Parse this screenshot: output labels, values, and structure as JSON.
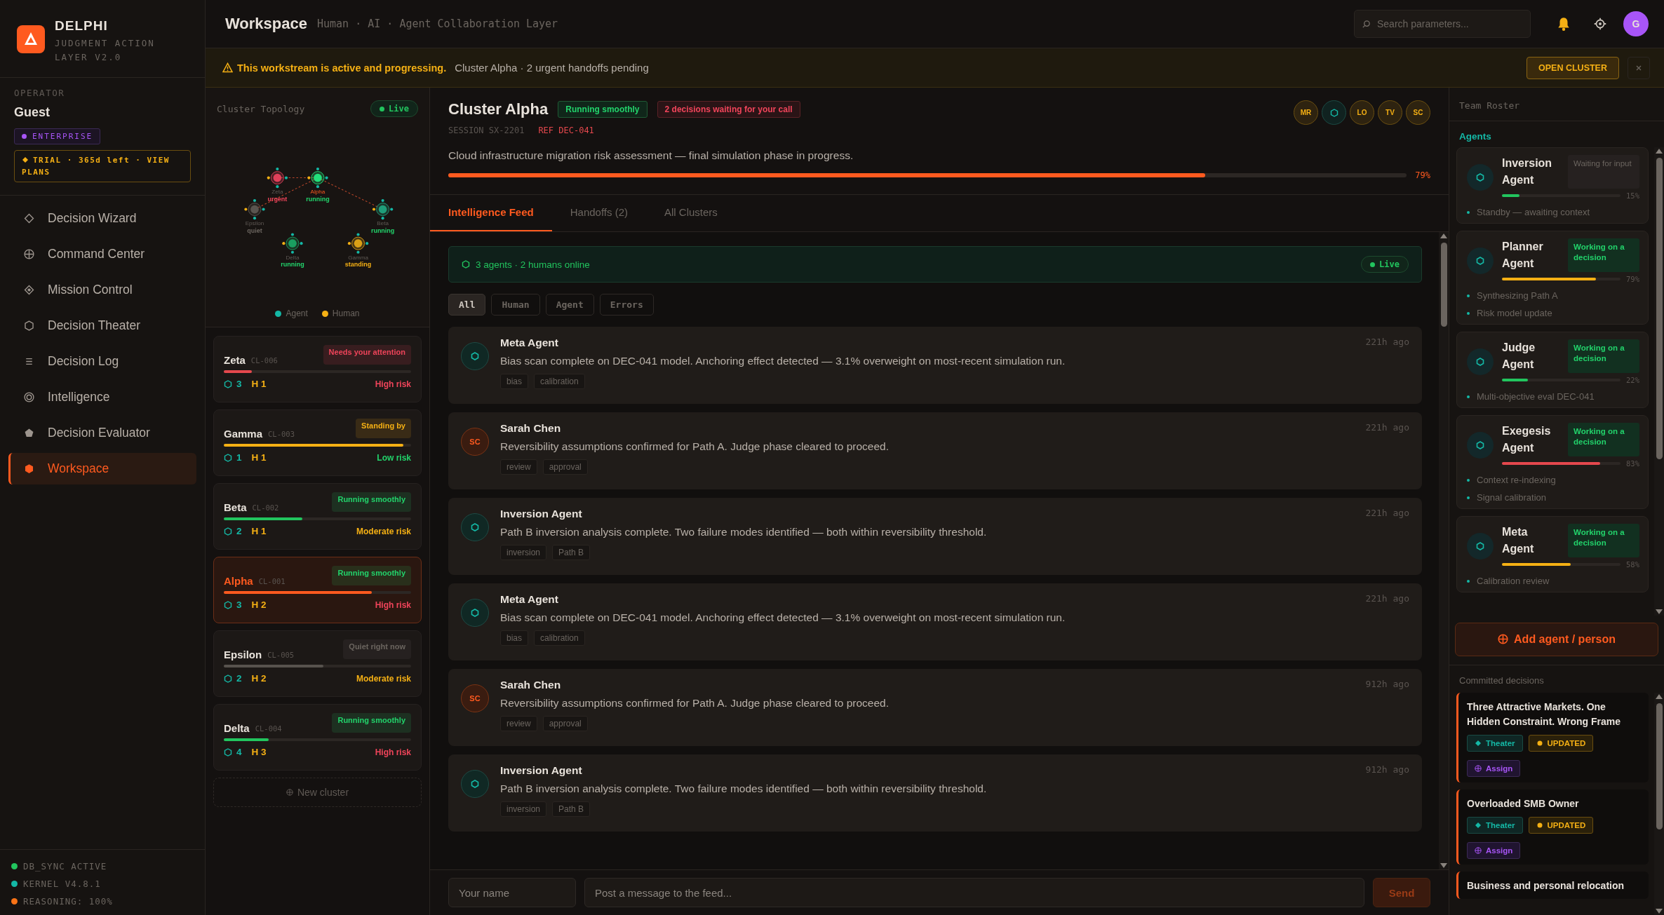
{
  "brand": {
    "name": "DELPHI",
    "tagline": "JUDGMENT ACTION LAYER V2.0"
  },
  "operator": {
    "label": "OPERATOR",
    "name": "Guest",
    "plan": "ENTERPRISE",
    "trial": "TRIAL · 365d left  ·  VIEW PLANS"
  },
  "nav": [
    {
      "label": "Decision Wizard",
      "kind": "wizard",
      "selected": false
    },
    {
      "label": "Command Center",
      "kind": "command",
      "selected": false
    },
    {
      "label": "Mission Control",
      "kind": "mission",
      "selected": false
    },
    {
      "label": "Decision Theater",
      "kind": "theater",
      "selected": false
    },
    {
      "label": "Decision Log",
      "kind": "log",
      "selected": false
    },
    {
      "label": "Intelligence",
      "kind": "intelligence",
      "selected": false
    },
    {
      "label": "Decision Evaluator",
      "kind": "evaluator",
      "selected": false
    },
    {
      "label": "Workspace",
      "kind": "workspace",
      "selected": true
    }
  ],
  "system_status": [
    {
      "label": "DB_SYNC ACTIVE",
      "color": "#22c55e"
    },
    {
      "label": "KERNEL V4.8.1",
      "color": "#14b8a6"
    },
    {
      "label": "REASONING: 100%",
      "color": "#f97316"
    }
  ],
  "header": {
    "title": "Workspace",
    "subtitle": "Human · AI · Agent Collaboration Layer",
    "search_placeholder": "Search parameters...",
    "avatar": "G"
  },
  "banner": {
    "alert": "This workstream is active and progressing.",
    "detail": "Cluster Alpha · 2 urgent handoffs pending",
    "action": "OPEN CLUSTER"
  },
  "topology": {
    "title": "Cluster Topology",
    "live": "Live",
    "nodes": [
      {
        "name": "Zeta",
        "status": {
          "text": "urgent",
          "color": "#f0445a"
        },
        "color": "#e0405a"
      },
      {
        "name": "Alpha",
        "status": {
          "text": "running",
          "color": "#22d36b"
        },
        "color": "#22e07a"
      },
      {
        "name": "Epsilon",
        "status": {
          "text": "quiet",
          "color": "#6b655f"
        },
        "color": "#5a5550"
      },
      {
        "name": "Beta",
        "status": {
          "text": "running",
          "color": "#22d36b"
        },
        "color": "#1f9e7a"
      },
      {
        "name": "Delta",
        "status": {
          "text": "running",
          "color": "#22d36b"
        },
        "color": "#1a9e60"
      },
      {
        "name": "Gamma",
        "status": {
          "text": "standing",
          "color": "#f5b014"
        },
        "color": "#d9a016"
      }
    ],
    "legend": [
      {
        "label": "Agent",
        "color": "#14b8a6"
      },
      {
        "label": "Human",
        "color": "#f5b014"
      }
    ]
  },
  "clusters": [
    {
      "name": "Zeta",
      "code": "CL-006",
      "status": {
        "text": "Needs your attention",
        "color": "#f0445a"
      },
      "level": 0.15,
      "color": "#e5484d",
      "agents": "3",
      "humans": "H 1",
      "risk": {
        "text": "High risk",
        "color": "#f0445a"
      },
      "selected": false
    },
    {
      "name": "Gamma",
      "code": "CL-003",
      "status": {
        "text": "Standing by",
        "color": "#f5b014"
      },
      "level": 0.96,
      "color": "#f5b014",
      "agents": "1",
      "humans": "H 1",
      "risk": {
        "text": "Low risk",
        "color": "#22d36b"
      },
      "selected": false
    },
    {
      "name": "Beta",
      "code": "CL-002",
      "status": {
        "text": "Running smoothly",
        "color": "#22d36b"
      },
      "level": 0.42,
      "color": "#22c55e",
      "agents": "2",
      "humans": "H 1",
      "risk": {
        "text": "Moderate risk",
        "color": "#f5b014"
      },
      "selected": false
    },
    {
      "name": "Alpha",
      "code": "CL-001",
      "status": {
        "text": "Running smoothly",
        "color": "#22d36b"
      },
      "level": 0.79,
      "color": "#ff5a1f",
      "agents": "3",
      "humans": "H 2",
      "risk": {
        "text": "High risk",
        "color": "#f0445a"
      },
      "selected": true
    },
    {
      "name": "Epsilon",
      "code": "CL-005",
      "status": {
        "text": "Quiet right now",
        "color": "#6b655f"
      },
      "level": 0.53,
      "color": "#57524d",
      "agents": "2",
      "humans": "H 2",
      "risk": {
        "text": "Moderate risk",
        "color": "#f5b014"
      },
      "selected": false
    },
    {
      "name": "Delta",
      "code": "CL-004",
      "status": {
        "text": "Running smoothly",
        "color": "#22d36b"
      },
      "level": 0.24,
      "color": "#22c55e",
      "agents": "4",
      "humans": "H 3",
      "risk": {
        "text": "High risk",
        "color": "#f0445a"
      },
      "selected": false
    }
  ],
  "new_cluster": "New cluster",
  "cluster": {
    "title": "Cluster Alpha",
    "status": "Running smoothly",
    "alert": "2 decisions waiting for your call",
    "session": "SESSION SX-2201",
    "ref": "REF DEC-041",
    "description": "Cloud infrastructure migration risk assessment — final simulation phase in progress.",
    "level": 0.79,
    "percent": "79%",
    "members": [
      {
        "kind": "human",
        "initials": "MR"
      },
      {
        "kind": "agent"
      },
      {
        "kind": "human",
        "initials": "LO"
      },
      {
        "kind": "human",
        "initials": "TV"
      },
      {
        "kind": "human",
        "initials": "SC"
      }
    ]
  },
  "tabs": [
    {
      "label": "Intelligence Feed",
      "selected": true
    },
    {
      "label": "Handoffs (2)",
      "selected": false
    },
    {
      "label": "All Clusters",
      "selected": false
    }
  ],
  "presence": {
    "text": "3 agents · 2 humans online",
    "live": "Live"
  },
  "filters": [
    {
      "label": "All",
      "selected": true
    },
    {
      "label": "Human",
      "selected": false
    },
    {
      "label": "Agent",
      "selected": false
    },
    {
      "label": "Errors",
      "selected": false
    }
  ],
  "feed": [
    {
      "author": "Meta Agent",
      "kind": "agent",
      "time": "221h ago",
      "text": "Bias scan complete on DEC-041 model. Anchoring effect detected — 3.1% overweight on most-recent simulation run.",
      "tags": [
        "bias",
        "calibration"
      ]
    },
    {
      "author": "Sarah Chen",
      "kind": "human",
      "initials": "SC",
      "time": "221h ago",
      "text": "Reversibility assumptions confirmed for Path A. Judge phase cleared to proceed.",
      "tags": [
        "review",
        "approval"
      ]
    },
    {
      "author": "Inversion Agent",
      "kind": "agent",
      "time": "221h ago",
      "text": "Path B inversion analysis complete. Two failure modes identified — both within reversibility threshold.",
      "tags": [
        "inversion",
        "Path B"
      ]
    },
    {
      "author": "Meta Agent",
      "kind": "agent",
      "time": "221h ago",
      "text": "Bias scan complete on DEC-041 model. Anchoring effect detected — 3.1% overweight on most-recent simulation run.",
      "tags": [
        "bias",
        "calibration"
      ]
    },
    {
      "author": "Sarah Chen",
      "kind": "human",
      "initials": "SC",
      "time": "912h ago",
      "text": "Reversibility assumptions confirmed for Path A. Judge phase cleared to proceed.",
      "tags": [
        "review",
        "approval"
      ]
    },
    {
      "author": "Inversion Agent",
      "kind": "agent",
      "time": "912h ago",
      "text": "Path B inversion analysis complete. Two failure modes identified — both within reversibility threshold.",
      "tags": [
        "inversion",
        "Path B"
      ]
    }
  ],
  "composer": {
    "name_placeholder": "Your name",
    "message_placeholder": "Post a message to the feed...",
    "send": "Send"
  },
  "roster": {
    "title": "Team Roster",
    "section": "Agents",
    "agents": [
      {
        "name": "Inversion Agent",
        "status": "Waiting for input",
        "working": false,
        "level": 0.15,
        "percent": "15%",
        "color": "#22c55e",
        "notes": [
          "Standby — awaiting context"
        ]
      },
      {
        "name": "Planner Agent",
        "status": "Working on a decision",
        "working": true,
        "level": 0.79,
        "percent": "79%",
        "color": "#f5b014",
        "notes": [
          "Synthesizing Path A",
          "Risk model update"
        ]
      },
      {
        "name": "Judge Agent",
        "status": "Working on a decision",
        "working": true,
        "level": 0.22,
        "percent": "22%",
        "color": "#22c55e",
        "notes": [
          "Multi-objective eval DEC-041"
        ]
      },
      {
        "name": "Exegesis Agent",
        "status": "Working on a decision",
        "working": true,
        "level": 0.83,
        "percent": "83%",
        "color": "#e5484d",
        "notes": [
          "Context re-indexing",
          "Signal calibration"
        ]
      },
      {
        "name": "Meta Agent",
        "status": "Working on a decision",
        "working": true,
        "level": 0.58,
        "percent": "58%",
        "color": "#f5b014",
        "notes": [
          "Calibration review"
        ]
      }
    ],
    "add": "Add agent / person"
  },
  "committed": {
    "title": "Committed decisions",
    "items": [
      {
        "title": "Three Attractive Markets. One Hidden Constraint. Wrong Frame",
        "theater": "Theater",
        "updated": "UPDATED",
        "assign": "Assign"
      },
      {
        "title": "Overloaded SMB Owner",
        "theater": "Theater",
        "updated": "UPDATED",
        "assign": "Assign"
      },
      {
        "title": "Business and personal relocation"
      }
    ]
  }
}
